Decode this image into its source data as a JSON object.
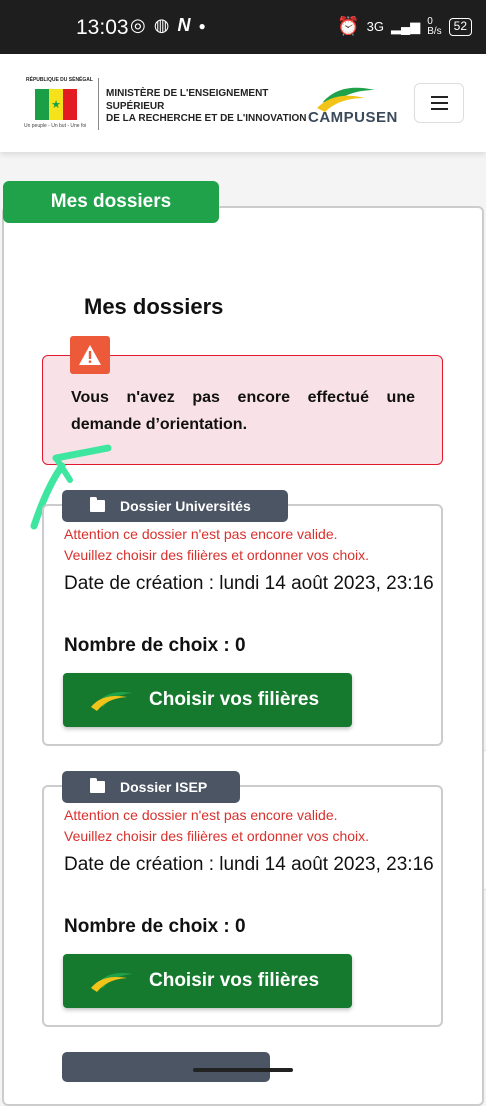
{
  "status_bar": {
    "time": "13:03",
    "network": "3G",
    "speed_value": "0",
    "speed_unit": "B/s",
    "battery": "52"
  },
  "header": {
    "republic": "RÉPUBLIQUE DU SÉNÉGAL",
    "motto": "Un peuple - Un but - Une foi",
    "ministry_line1": "MINISTÈRE DE L'ENSEIGNEMENT SUPÉRIEUR",
    "ministry_line2": "DE LA RECHERCHE ET DE L'INNOVATION",
    "brand": "CAMPUSEN",
    "flag_colors": [
      "#1a9e46",
      "#f5e21b",
      "#e31b23"
    ]
  },
  "panel": {
    "tab_label": "Mes dossiers",
    "title": "Mes dossiers"
  },
  "alert": {
    "message": "Vous n'avez pas encore effectué une demande d’orientation."
  },
  "dossiers": [
    {
      "tag": "Dossier Universités",
      "warning_line1": "Attention ce dossier n'est pas encore valide.",
      "warning_line2": "Veuillez choisir des filières et ordonner vos choix.",
      "created": "Date de création : lundi 14 août 2023, 23:16",
      "choices": "Nombre de choix : 0",
      "button": "Choisir vos filières"
    },
    {
      "tag": "Dossier ISEP",
      "warning_line1": "Attention ce dossier n'est pas encore valide.",
      "warning_line2": "Veuillez choisir des filières et ordonner vos choix.",
      "created": "Date de création : lundi 14 août 2023, 23:16",
      "choices": "Nombre de choix : 0",
      "button": "Choisir vos filières"
    }
  ],
  "colors": {
    "primary_green": "#1fa24a",
    "button_green": "#157a2e",
    "alert_border": "#e0192e",
    "warning_text": "#d9302c",
    "annotation_arrow": "#3ee6a0"
  }
}
